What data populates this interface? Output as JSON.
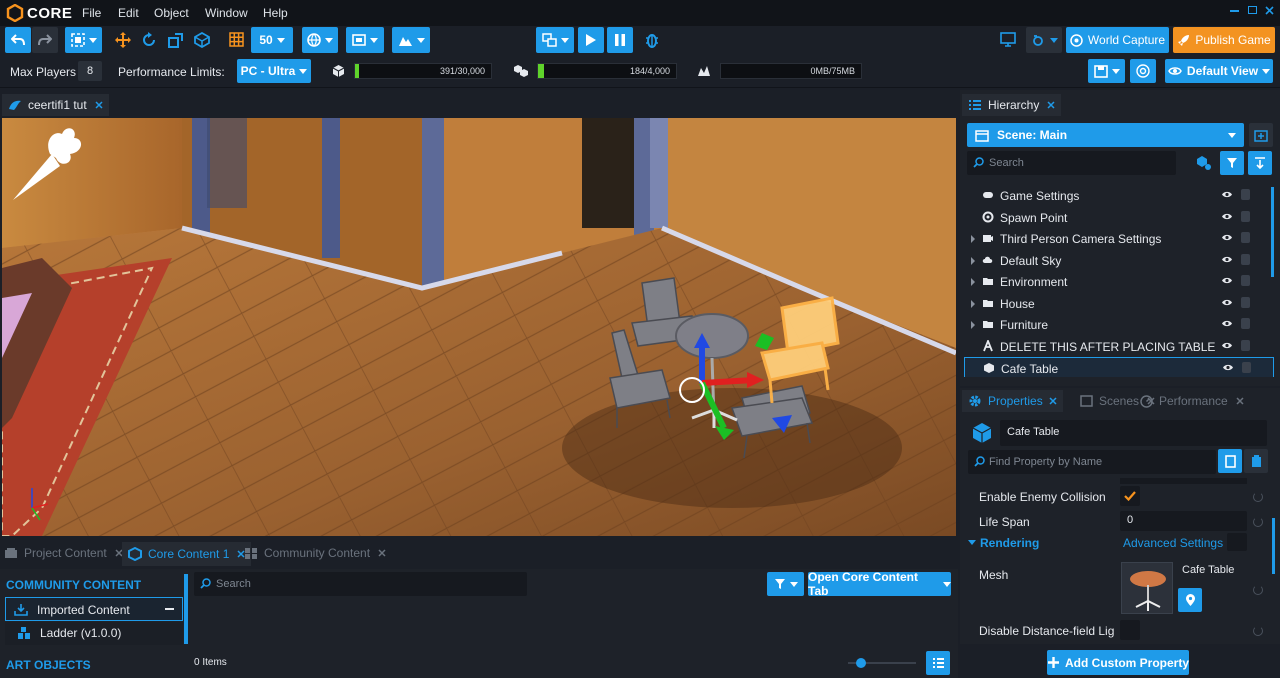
{
  "app": {
    "name": "CORE"
  },
  "menu": [
    "File",
    "Edit",
    "Object",
    "Window",
    "Help"
  ],
  "toolbar": {
    "snap_value": "50",
    "world_capture": "World Capture",
    "publish_game": "Publish Game"
  },
  "perf": {
    "max_players_label": "Max Players",
    "max_players_value": "8",
    "limits_label": "Performance Limits:",
    "platform": "PC - Ultra",
    "meters": [
      {
        "icon": "cube-icon",
        "text": "391/30,000",
        "fill": 0.013
      },
      {
        "icon": "cubes-icon",
        "text": "184/4,000",
        "fill": 0.046
      },
      {
        "icon": "network-icon",
        "text": "0MB/75MB",
        "fill": 0.0
      }
    ],
    "default_view": "Default View"
  },
  "viewport": {
    "tab_label": "ceertifi1 tut"
  },
  "hierarchy": {
    "tab_label": "Hierarchy",
    "scene": "Scene: Main",
    "search_placeholder": "Search",
    "items": [
      {
        "label": "Game Settings",
        "icon": "gamepad-icon",
        "expandable": false
      },
      {
        "label": "Spawn Point",
        "icon": "spawn-icon",
        "expandable": false
      },
      {
        "label": "Third Person Camera Settings",
        "icon": "camera-icon",
        "expandable": true
      },
      {
        "label": "Default Sky",
        "icon": "sky-icon",
        "expandable": true
      },
      {
        "label": "Environment",
        "icon": "folder-icon",
        "expandable": true
      },
      {
        "label": "House",
        "icon": "folder-icon",
        "expandable": true
      },
      {
        "label": "Furniture",
        "icon": "folder-icon",
        "expandable": true
      },
      {
        "label": "DELETE THIS AFTER PLACING TABLE",
        "icon": "text-icon",
        "expandable": false
      },
      {
        "label": "Cafe Table",
        "icon": "cube-icon",
        "expandable": false,
        "selected": true
      }
    ]
  },
  "properties": {
    "tabs": [
      "Properties",
      "Scenes",
      "Performance"
    ],
    "object_name": "Cafe Table",
    "find_placeholder": "Find Property by Name",
    "enable_enemy_collision": "Enable Enemy Collision",
    "life_span_label": "Life Span",
    "life_span_value": "0",
    "rendering_section": "Rendering",
    "advanced_settings": "Advanced Settings",
    "mesh_label": "Mesh",
    "mesh_value": "Cafe Table",
    "disable_df": "Disable Distance-field Lig",
    "add_custom": "Add Custom Property"
  },
  "bottom": {
    "tabs": [
      "Project Content",
      "Core Content 1",
      "Community Content"
    ],
    "community_header": "COMMUNITY CONTENT",
    "imported": "Imported Content",
    "ladder": "Ladder (v1.0.0)",
    "art_objects": "ART OBJECTS",
    "search_placeholder": "Search",
    "open_tab": "Open Core Content Tab",
    "items_count": "0 Items"
  }
}
